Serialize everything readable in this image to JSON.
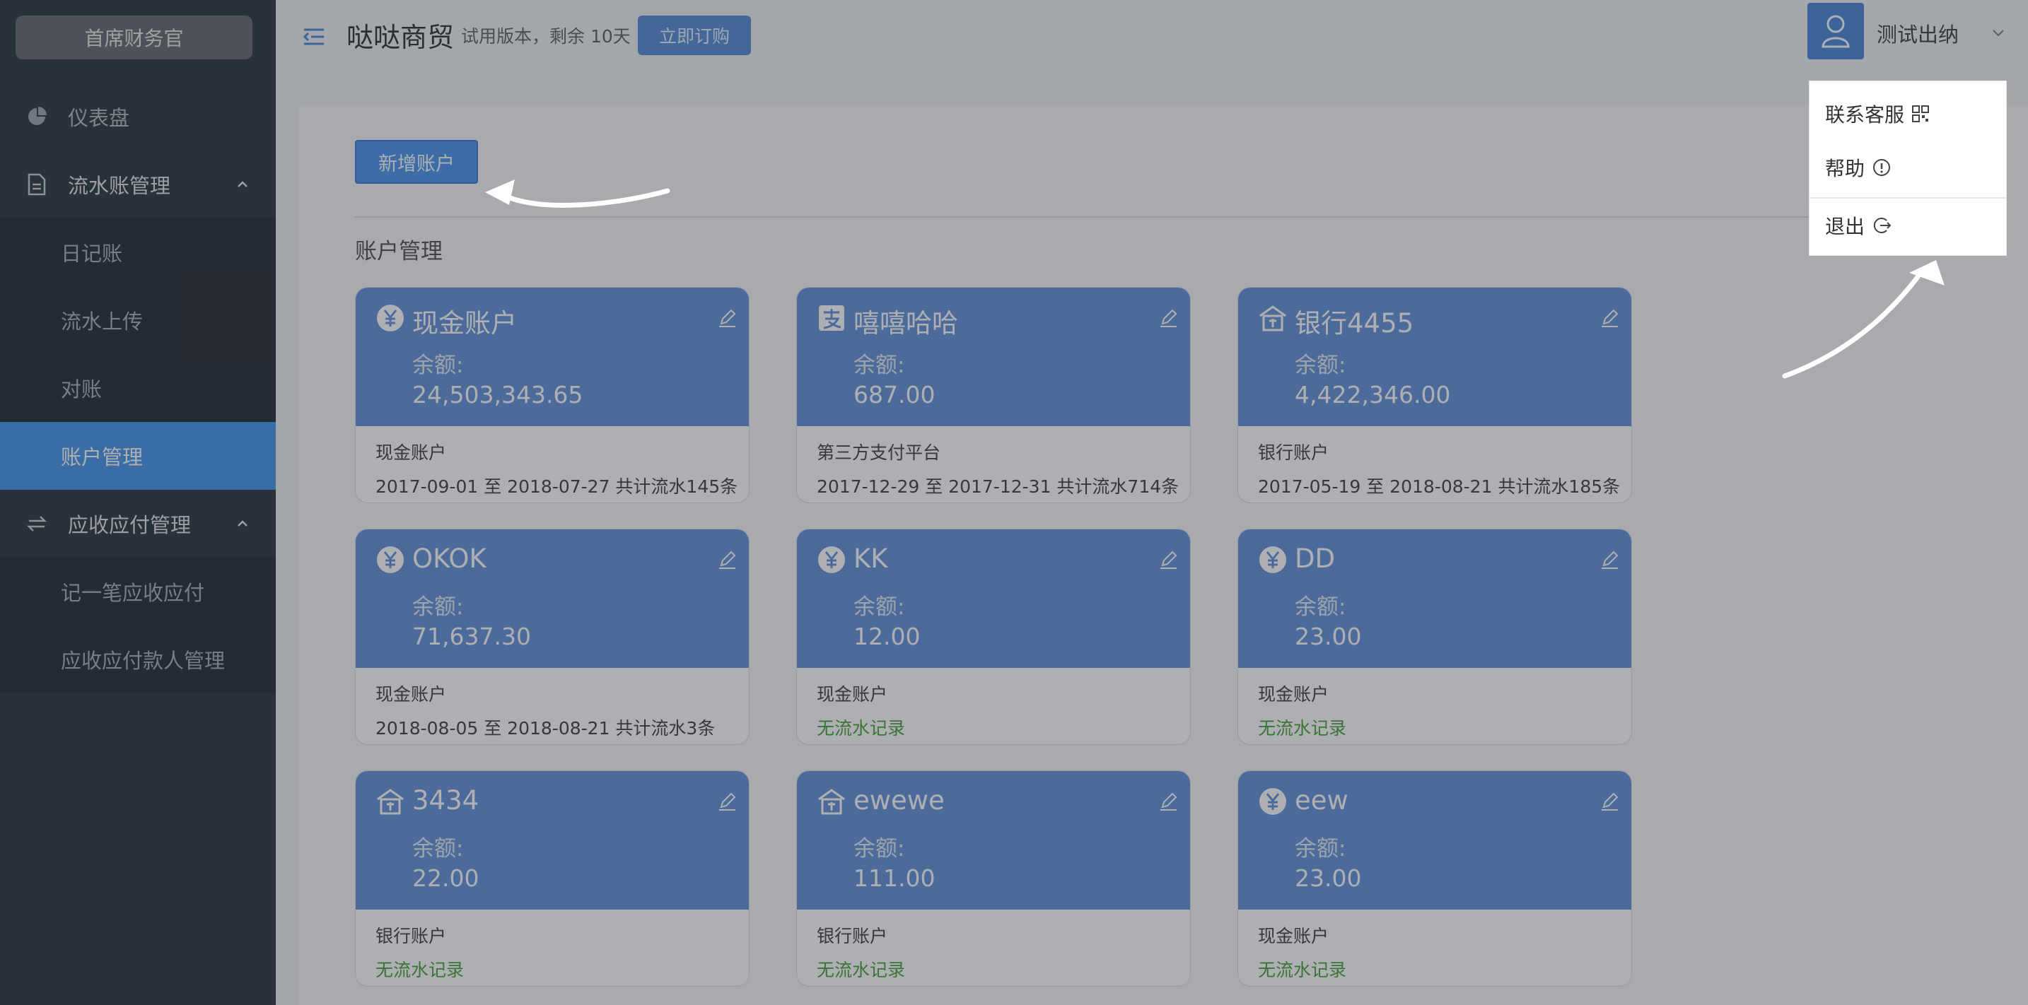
{
  "sidebar": {
    "brand": "首席财务官",
    "items": [
      {
        "label": "仪表盘",
        "icon": "pie-chart-icon"
      },
      {
        "label": "流水账管理",
        "icon": "document-icon"
      },
      {
        "label": "应收应付管理",
        "icon": "swap-icon"
      }
    ],
    "sub_ledger": [
      "日记账",
      "流水上传",
      "对账",
      "账户管理"
    ],
    "sub_receivable": [
      "记一笔应收应付",
      "应收应付款人管理"
    ],
    "active": "账户管理"
  },
  "topbar": {
    "company": "哒哒商贸",
    "trial": "试用版本，剩余 10天",
    "buy_label": "立即订购",
    "user_name": "测试出纳"
  },
  "user_menu": {
    "contact": "联系客服",
    "help": "帮助",
    "logout": "退出"
  },
  "main": {
    "add_account_label": "新增账户",
    "section_title": "账户管理",
    "balance_label": "余额:",
    "accounts": [
      {
        "name": "现金账户",
        "icon": "yuan-coin-icon",
        "balance": "24,503,343.65",
        "type": "现金账户",
        "records": "2017-09-01 至 2018-07-27 共计流水145条"
      },
      {
        "name": "嘻嘻哈哈",
        "icon": "payment-platform-icon",
        "balance": "687.00",
        "type": "第三方支付平台",
        "records": "2017-12-29 至 2017-12-31 共计流水714条"
      },
      {
        "name": "银行4455",
        "icon": "bank-icon",
        "balance": "4,422,346.00",
        "type": "银行账户",
        "records": "2017-05-19 至 2018-08-21 共计流水185条"
      },
      {
        "name": "OKOK",
        "icon": "yuan-coin-icon",
        "balance": "71,637.30",
        "type": "现金账户",
        "records": "2018-08-05 至 2018-08-21 共计流水3条"
      },
      {
        "name": "KK",
        "icon": "yuan-coin-icon",
        "balance": "12.00",
        "type": "现金账户",
        "records": "无流水记录"
      },
      {
        "name": "DD",
        "icon": "yuan-coin-icon",
        "balance": "23.00",
        "type": "现金账户",
        "records": "无流水记录"
      },
      {
        "name": "3434",
        "icon": "bank-icon",
        "balance": "22.00",
        "type": "银行账户",
        "records": "无流水记录"
      },
      {
        "name": "ewewe",
        "icon": "bank-icon",
        "balance": "111.00",
        "type": "银行账户",
        "records": "无流水记录"
      },
      {
        "name": "eew",
        "icon": "yuan-coin-icon",
        "balance": "23.00",
        "type": "现金账户",
        "records": "无流水记录"
      }
    ]
  },
  "colors": {
    "sidebar_bg": "#1f2633",
    "active_item": "#3a8ee8",
    "card_header": "#5a8ad6",
    "no_records": "#3a9a2a"
  }
}
